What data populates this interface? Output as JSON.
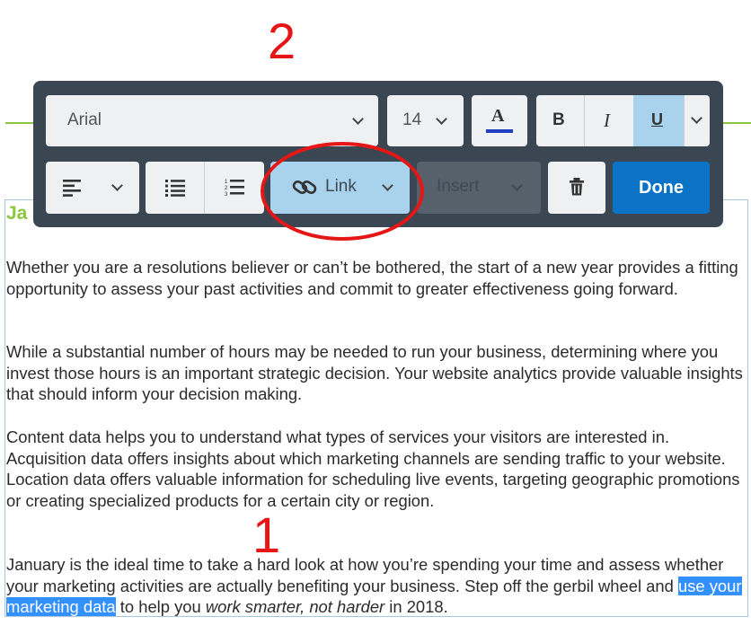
{
  "toolbar": {
    "font_family": "Arial",
    "font_size": "14",
    "font_color_label": "A",
    "font_color_swatch": "#1f3fbf",
    "bold_label": "B",
    "italic_label": "I",
    "underline_label": "U",
    "link_label": "Link",
    "insert_label": "Insert",
    "done_label": "Done"
  },
  "content": {
    "heading": "Ja",
    "paragraphs": [
      "Whether you are a resolutions believer or can’t be bothered, the start of a new year provides a fitting opportunity to assess your past activities and commit to greater effectiveness going forward.",
      "While a substantial number of hours may be needed to run your business, determining where you invest those hours is an important strategic decision. Your website analytics provide valuable insights that should inform your decision making.",
      "Content data helps you to understand what types of services your visitors are interested in. Acquisition data offers insights about which marketing channels are sending traffic to your website. Location data offers valuable information for scheduling live events, targeting geographic promotions or creating specialized products for a certain city or region."
    ],
    "last_paragraph": {
      "before": "January is the ideal time to take a hard look at how you’re spending your time and assess whether your marketing activities are actually benefiting your business. Step off the gerbil wheel and ",
      "selected": "use your marketing data",
      "middle": " to help you ",
      "italic": "work smarter, not harder",
      "after": " in 2018."
    }
  },
  "annotations": {
    "step_1": "1",
    "step_2": "2"
  },
  "colors": {
    "toolbar_bg": "#3b4653",
    "active_button": "#a9d3ec",
    "done_button": "#0a73c6",
    "heading_green": "#8cc63f",
    "annotation_red": "#e51616",
    "selection": "#3390ff"
  }
}
